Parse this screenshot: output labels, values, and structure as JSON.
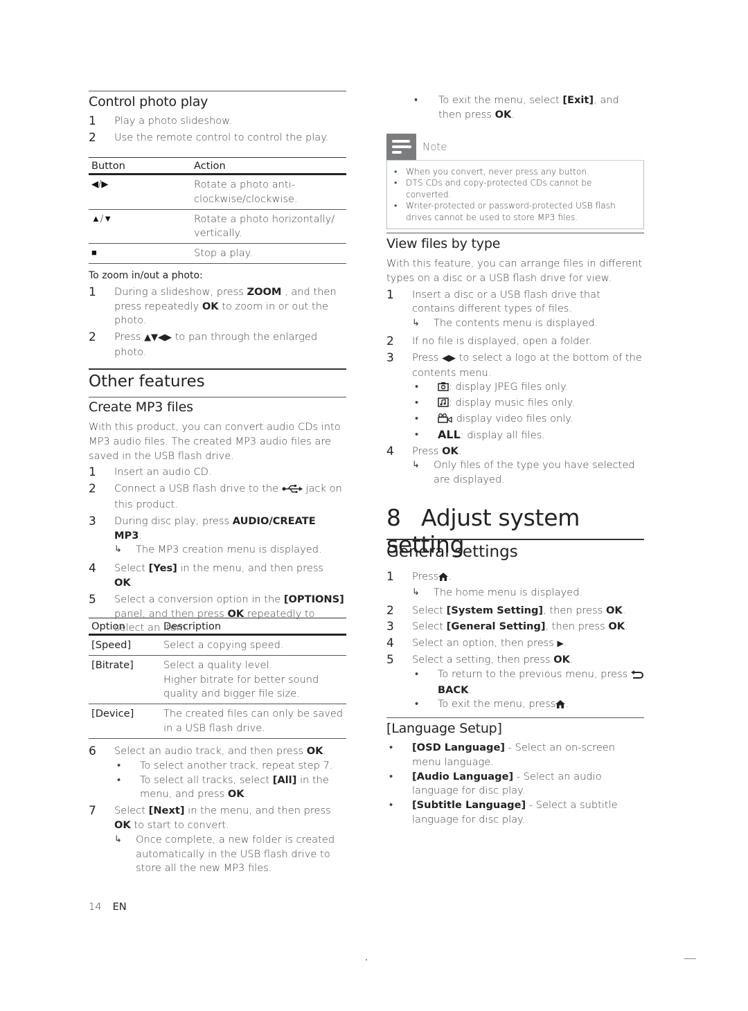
{
  "left": {
    "control_photo_play": {
      "title": "Control photo play",
      "steps": [
        {
          "num": "1",
          "text": "Play a photo slideshow."
        },
        {
          "num": "2",
          "text": "Use the remote control to control the play."
        }
      ],
      "table": {
        "headers": [
          "Button",
          "Action"
        ],
        "rows": [
          {
            "button": "◀/▶",
            "action": "Rotate a photo anti-clockwise/clockwise."
          },
          {
            "button": "▲/▼",
            "action": "Rotate a photo horizontally/ vertically."
          },
          {
            "button": "■",
            "action": "Stop a play."
          }
        ]
      },
      "zoom_label": "To zoom in/out a photo:",
      "zoom_steps": [
        {
          "num": "1",
          "pre": "During a slideshow, press ",
          "key1": "ZOOM",
          "mid": " , and then press repeatedly ",
          "key2": "OK",
          "post": " to zoom in or out the photo."
        },
        {
          "num": "2",
          "pre": "Press ",
          "key1": "▲▼◀▶",
          "post": " to pan through the enlarged photo."
        }
      ]
    },
    "other_features": {
      "title": "Other features"
    },
    "create_mp3": {
      "title": "Create MP3 files",
      "intro": "With this product, you can convert audio CDs into MP3 audio files. The created MP3 audio files are saved in the USB flash drive.",
      "steps": [
        {
          "num": "1",
          "text": "Insert an audio CD."
        },
        {
          "num": "2",
          "pre": "Connect a USB flash drive to the ",
          "icon": "usb-icon",
          "post": " jack on this product."
        },
        {
          "num": "3",
          "pre": "During disc play, press ",
          "key": "AUDIO/CREATE MP3",
          "post": ".",
          "result": "The MP3 creation menu is displayed."
        },
        {
          "num": "4",
          "pre": "Select ",
          "key": "[Yes]",
          "mid": " in the menu, and then press ",
          "key2": "OK",
          "post": "."
        },
        {
          "num": "5",
          "pre": "Select a conversion option in the ",
          "key": "[OPTIONS]",
          "mid": " panel, and then press ",
          "key2": "OK",
          "post": " repeatedly to select an item."
        }
      ],
      "table": {
        "headers": [
          "Option",
          "Description"
        ],
        "rows": [
          {
            "option": "[Speed]",
            "description": "Select a copying speed."
          },
          {
            "option": "[Bitrate]",
            "description": "Select a quality level.\nHigher bitrate for better sound quality and bigger file size."
          },
          {
            "option": "[Device]",
            "description": "The created files can only be saved in a USB flash drive."
          }
        ]
      },
      "steps2": [
        {
          "num": "6",
          "pre": "Select an audio track, and then press ",
          "key": "OK",
          "post": ".",
          "bullets": [
            {
              "text": "To select another track, repeat step 7."
            },
            {
              "pre": "To select all tracks, select ",
              "key": "[All]",
              "mid": " in the menu, and press ",
              "key2": "OK",
              "post": "."
            }
          ]
        },
        {
          "num": "7",
          "pre": "Select ",
          "key": "[Next]",
          "mid": " in the menu, and then press ",
          "key2": "OK",
          "post": " to start to convert.",
          "result": "Once complete, a new folder is created automatically in the USB flash drive to store all the new MP3 files."
        }
      ]
    }
  },
  "right": {
    "exit_bullet": {
      "pre": "To exit the menu, select ",
      "key": "[Exit]",
      "mid": ", and then press ",
      "key2": "OK",
      "post": "."
    },
    "note": {
      "title": "Note",
      "items": [
        "When you convert, never press any button.",
        "DTS CDs and copy-protected CDs cannot be converted.",
        "Writer-protected or password-protected USB flash drives cannot be used to store MP3 files."
      ]
    },
    "view_files": {
      "title": "View files by type",
      "intro": "With this feature, you can arrange files in different types on a disc or a USB flash drive for view.",
      "steps": [
        {
          "num": "1",
          "text": "Insert a disc or a USB flash drive that contains different types of files.",
          "result": "The contents menu is displayed."
        },
        {
          "num": "2",
          "text": "If no file is displayed, open a folder."
        },
        {
          "num": "3",
          "pre": "Press ",
          "key": "◀▶",
          "post": " to select a logo at the bottom of the contents menu.",
          "bullets": [
            {
              "icon": "photo-icon",
              "text": ": display JPEG files only."
            },
            {
              "icon": "music-icon",
              "text": ": display music files only."
            },
            {
              "icon": "video-icon",
              "text": " display video files only."
            },
            {
              "key": "ALL",
              "text": ": display all files."
            }
          ]
        },
        {
          "num": "4",
          "pre": "Press ",
          "key": "OK",
          "post": ".",
          "result": "Only files of the type you have selected are displayed."
        }
      ]
    },
    "chapter": {
      "number": "8",
      "title": "Adjust system setting"
    },
    "general_settings": {
      "title": "General settings",
      "steps": [
        {
          "num": "1",
          "pre": "Press",
          "icon": "home-icon",
          "post": ".",
          "result": "The home menu is displayed."
        },
        {
          "num": "2",
          "pre": "Select ",
          "key": "[System Setting]",
          "mid": ", then press ",
          "key2": "OK",
          "post": "."
        },
        {
          "num": "3",
          "pre": "Select ",
          "key": "[General Setting]",
          "mid": ", then press ",
          "key2": "OK",
          "post": "."
        },
        {
          "num": "4",
          "pre": "Select an option, then press ",
          "key": "▶",
          "post": "."
        },
        {
          "num": "5",
          "pre": "Select a setting, then press ",
          "key": "OK",
          "post": ".",
          "bullets": [
            {
              "pre": "To return to the previous menu, press ",
              "icon": "back-icon",
              "key": "BACK",
              "post": "."
            },
            {
              "pre": "To exit the menu, press",
              "icon": "home-icon",
              "post": "."
            }
          ]
        }
      ]
    },
    "language_setup": {
      "title": "[Language Setup]",
      "items": [
        {
          "key": "[OSD Language]",
          "text": " - Select an on-screen menu language."
        },
        {
          "key": "[Audio Language]",
          "text": " - Select an audio language for disc play."
        },
        {
          "key": "[Subtitle Language]",
          "text": " - Select a subtitle language for disc play."
        }
      ]
    }
  },
  "footer": {
    "page": "14",
    "lang": "EN"
  }
}
